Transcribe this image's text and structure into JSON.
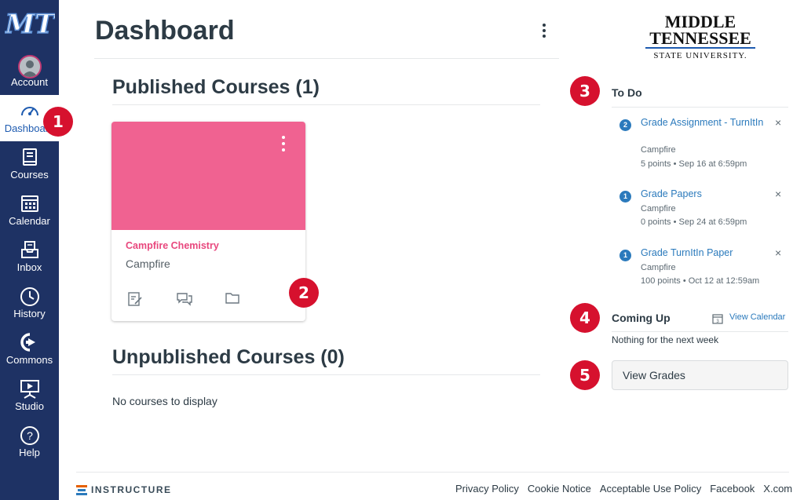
{
  "nav": {
    "logo_text": "MT",
    "items": [
      {
        "label": "Account"
      },
      {
        "label": "Dashboard"
      },
      {
        "label": "Courses"
      },
      {
        "label": "Calendar"
      },
      {
        "label": "Inbox"
      },
      {
        "label": "History"
      },
      {
        "label": "Commons"
      },
      {
        "label": "Studio"
      },
      {
        "label": "Help"
      }
    ]
  },
  "header": {
    "title": "Dashboard"
  },
  "published": {
    "title": "Published Courses (1)",
    "card": {
      "title": "Campfire Chemistry",
      "subtitle": "Campfire",
      "color": "#f06291"
    }
  },
  "unpublished": {
    "title": "Unpublished Courses (0)",
    "empty_text": "No courses to display"
  },
  "sidebar": {
    "brand": {
      "line1": "MIDDLE",
      "line2": "TENNESSEE",
      "line3": "STATE UNIVERSITY."
    },
    "todo": {
      "title": "To Do",
      "items": [
        {
          "count": "2",
          "title": "Grade Assignment - TurnItIn",
          "course": "Campfire",
          "details": "5 points • Sep 16 at 6:59pm"
        },
        {
          "count": "1",
          "title": "Grade Papers",
          "course": "Campfire",
          "details": "0 points • Sep 24 at 6:59pm"
        },
        {
          "count": "1",
          "title": "Grade TurnItIn Paper",
          "course": "Campfire",
          "details": "100 points • Oct 12 at 12:59am"
        }
      ],
      "dismiss": "×"
    },
    "coming_up": {
      "title": "Coming Up",
      "view_calendar": "View Calendar",
      "empty_text": "Nothing for the next week"
    },
    "view_grades": "View Grades"
  },
  "badges": [
    "1",
    "2",
    "3",
    "4",
    "5"
  ],
  "footer": {
    "logo": "INSTRUCTURE",
    "links": [
      "Privacy Policy",
      "Cookie Notice",
      "Acceptable Use Policy",
      "Facebook",
      "X.com"
    ]
  },
  "colors": {
    "nav_bg": "#1e3264",
    "link": "#2b7abc",
    "badge": "#d6112e",
    "card": "#f06291"
  }
}
